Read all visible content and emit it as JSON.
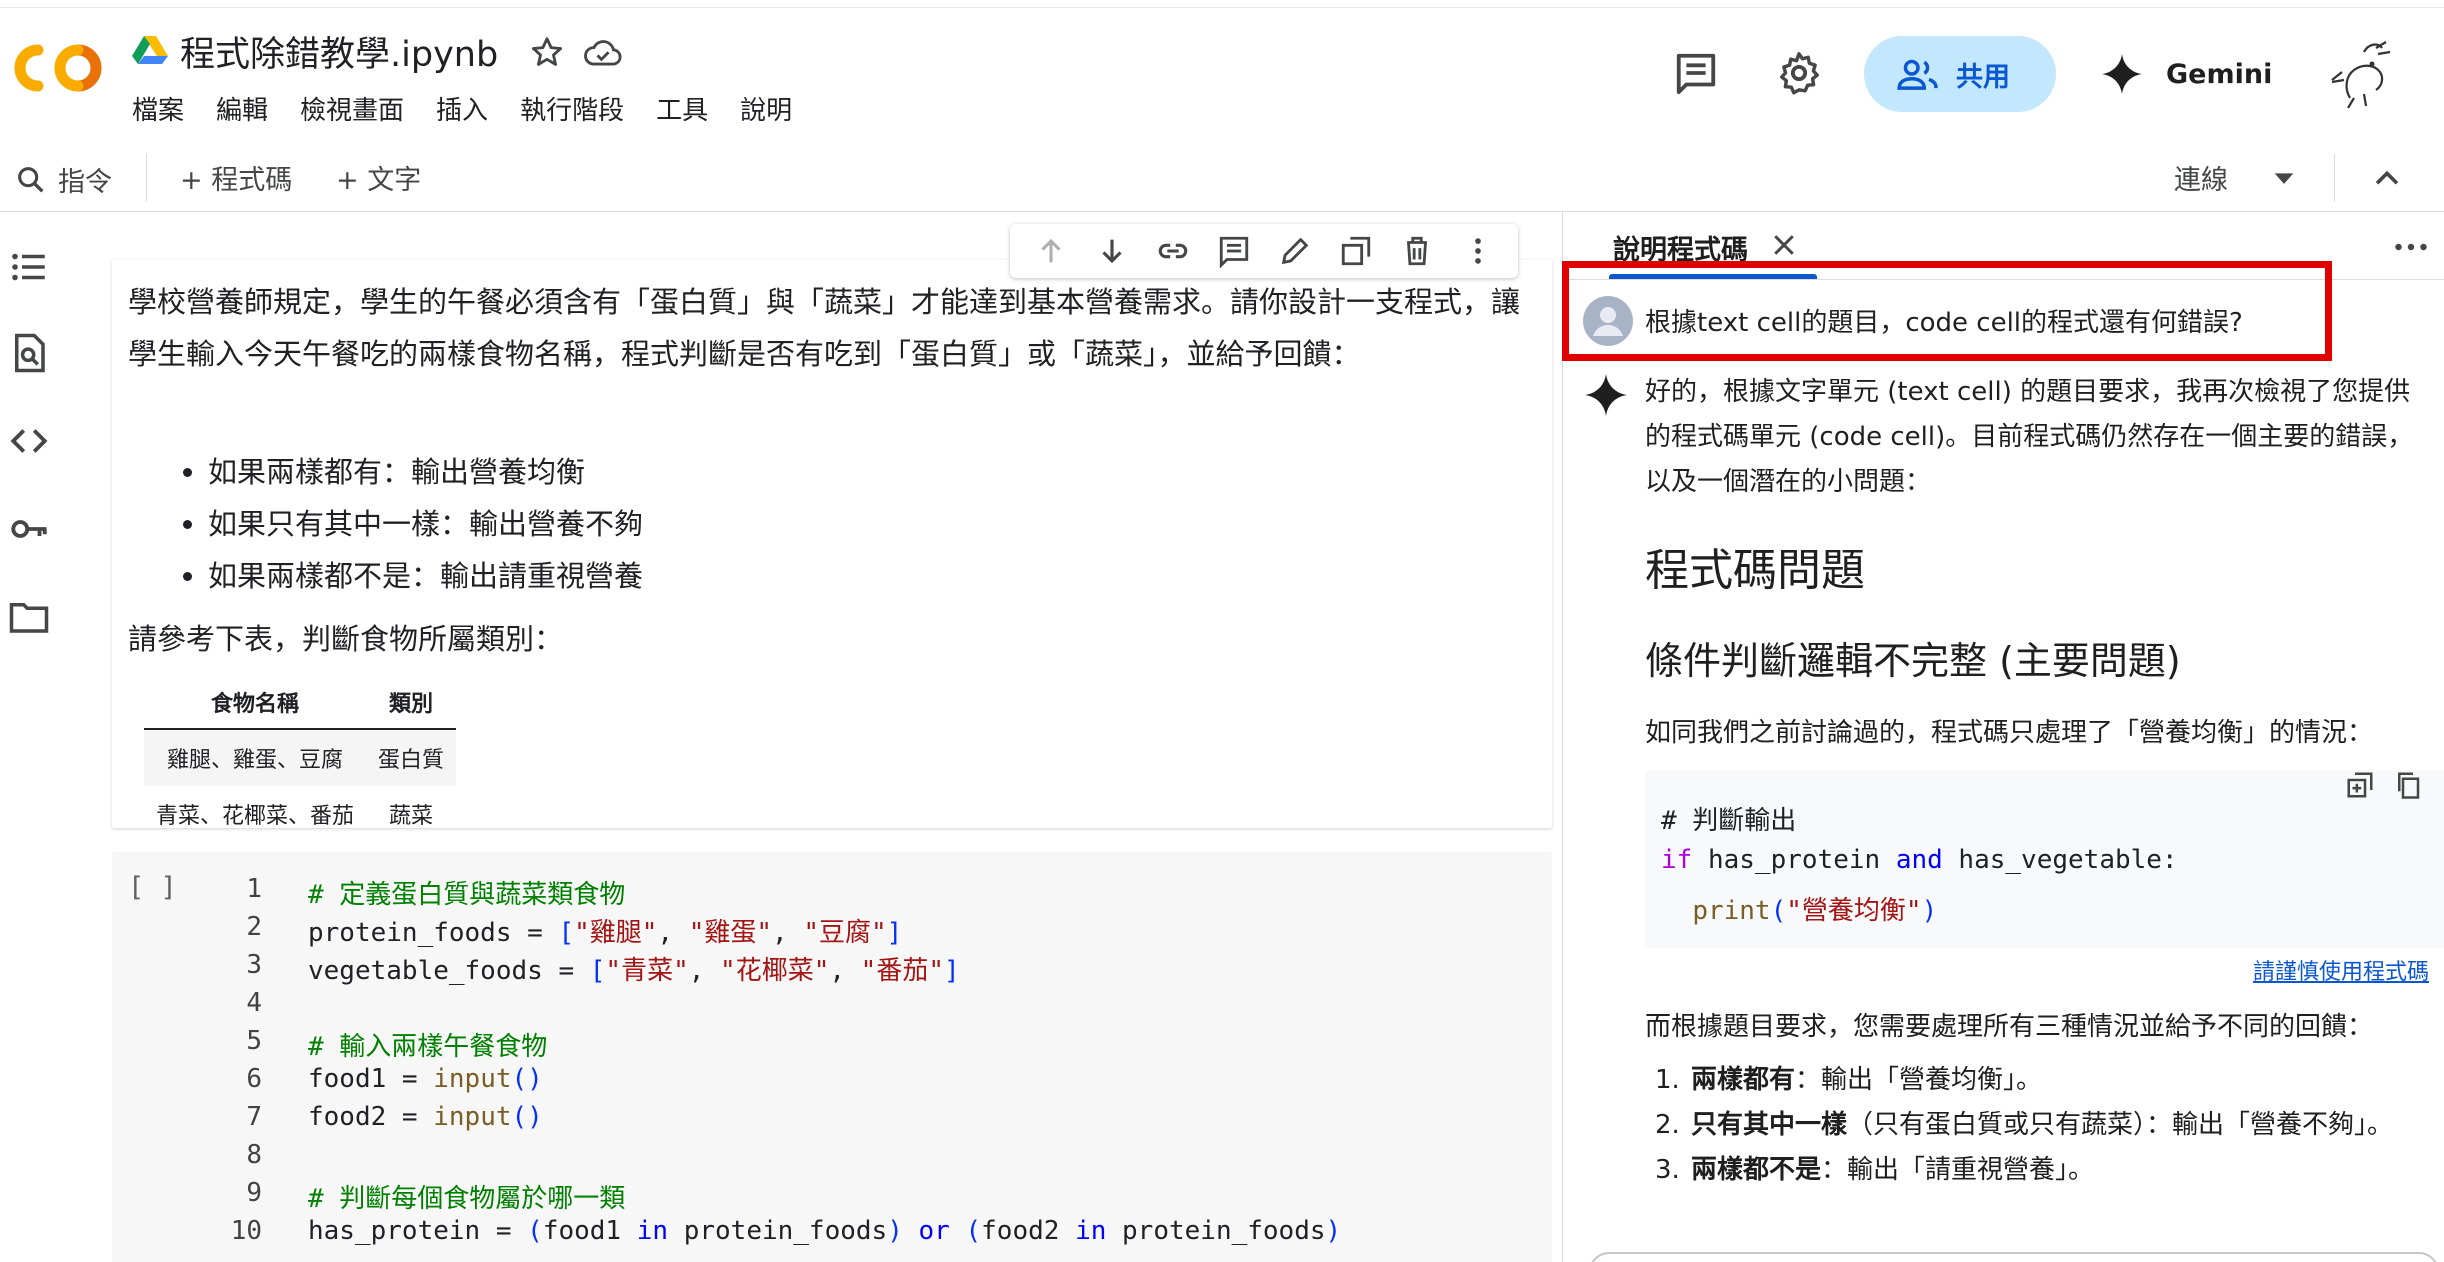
{
  "app": {
    "title": "程式除錯教學.ipynb",
    "menu": [
      "檔案",
      "編輯",
      "檢視畫面",
      "插入",
      "執行階段",
      "工具",
      "說明"
    ],
    "share_label": "共用",
    "gemini_label": "Gemini"
  },
  "toolbar": {
    "commands_label": "指令",
    "add_code_label": "+ 程式碼",
    "add_text_label": "+ 文字",
    "connect_label": "連線"
  },
  "text_cell": {
    "paragraph": "學校營養師規定，學生的午餐必須含有「蛋白質」與「蔬菜」才能達到基本營養需求。請你設計一支程式，讓學生輸入今天午餐吃的兩樣食物名稱，程式判斷是否有吃到「蛋白質」或「蔬菜」，並給予回饋：",
    "bullets": [
      "如果兩樣都有：輸出營養均衡",
      "如果只有其中一樣：輸出營養不夠",
      "如果兩樣都不是：輸出請重視營養"
    ],
    "ref_text": "請參考下表，判斷食物所屬類別：",
    "table": {
      "headers": [
        "食物名稱",
        "類別"
      ],
      "rows": [
        [
          "雞腿、雞蛋、豆腐",
          "蛋白質"
        ],
        [
          "青菜、花椰菜、番茄",
          "蔬菜"
        ]
      ]
    }
  },
  "code_cell": {
    "run_label": "[ ]",
    "line_numbers": [
      "1",
      "2",
      "3",
      "4",
      "5",
      "6",
      "7",
      "8",
      "9",
      "10"
    ],
    "lines": [
      "# 定義蛋白質與蔬菜類食物",
      "protein_foods = [\"雞腿\", \"雞蛋\", \"豆腐\"]",
      "vegetable_foods = [\"青菜\", \"花椰菜\", \"番茄\"]",
      "",
      "# 輸入兩樣午餐食物",
      "food1 = input()",
      "food2 = input()",
      "",
      "# 判斷每個食物屬於哪一類",
      "has_protein = (food1 in protein_foods) or (food2 in protein_foods)"
    ]
  },
  "panel": {
    "tab_label": "說明程式碼",
    "user_message": "根據text cell的題目，code cell的程式還有何錯誤?",
    "ai_intro": "好的，根據文字單元 (text cell) 的題目要求，我再次檢視了您提供的程式碼單元 (code cell)。目前程式碼仍然存在一個主要的錯誤，以及一個潛在的小問題：",
    "heading1": "程式碼問題",
    "heading2": "條件判斷邏輯不完整 (主要問題)",
    "para1": "如同我們之前討論過的，程式碼只處理了「營養均衡」的情況：",
    "snippet": [
      "# 判斷輸出",
      "if has_protein and has_vegetable:",
      "  print(\"營養均衡\")"
    ],
    "caution_link": "請謹慎使用程式碼",
    "para2": "而根據題目要求，您需要處理所有三種情況並給予不同的回饋：",
    "list": [
      {
        "num": "1.",
        "bold": "兩樣都有",
        "rest": "：輸出「營養均衡」。"
      },
      {
        "num": "2.",
        "bold": "只有其中一樣",
        "rest": "（只有蛋白質或只有蔬菜）：輸出「營養不夠」。"
      },
      {
        "num": "3.",
        "bold": "兩樣都不是",
        "rest": "：輸出「請重視營養」。"
      }
    ]
  },
  "colors": {
    "accent": "#0b57d0",
    "share_bg": "#c2e7ff",
    "highlight": "#e00000"
  },
  "icons": [
    "colab-logo",
    "drive-icon",
    "star-icon",
    "cloud-icon",
    "comment-icon",
    "settings-icon",
    "share-people-icon",
    "gemini-spark-icon",
    "user-avatar",
    "search-icon",
    "caret-down-icon",
    "collapse-up-icon",
    "toc-icon",
    "find-icon",
    "code-snippets-icon",
    "key-icon",
    "folder-icon",
    "arrow-up-icon",
    "arrow-down-icon",
    "link-icon",
    "comment-icon",
    "pencil-icon",
    "mirror-cell-icon",
    "trash-icon",
    "more-vert-icon",
    "close-icon",
    "insert-icon",
    "copy-icon"
  ]
}
